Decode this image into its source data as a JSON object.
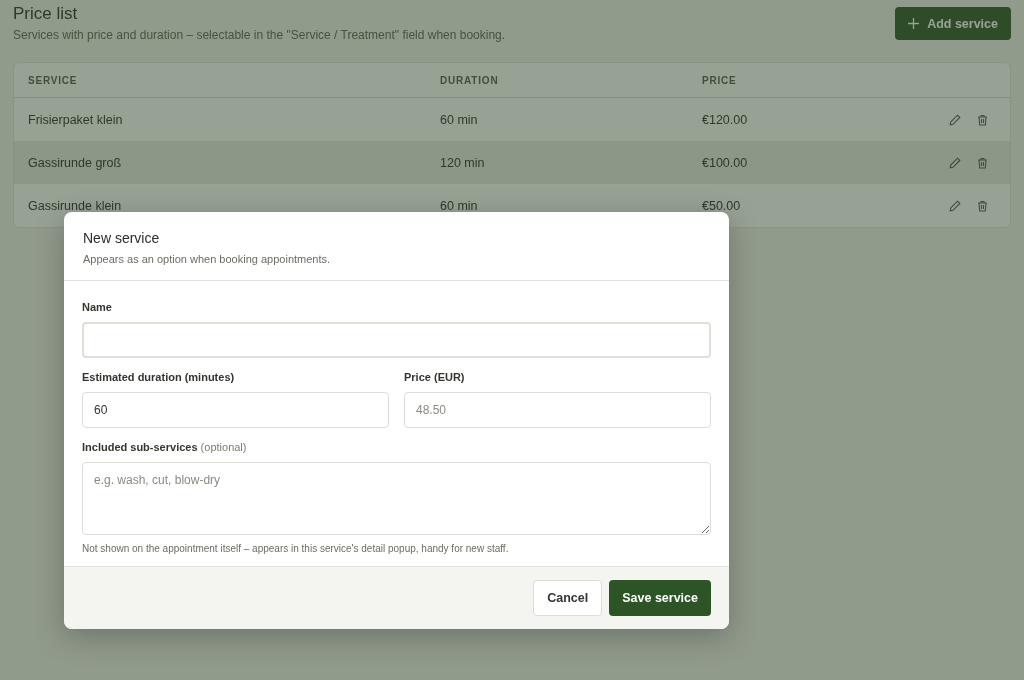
{
  "page": {
    "title": "Price list",
    "subtitle": "Services with price and duration – selectable in the \"Service / Treatment\" field when booking.",
    "add_button": "Add service"
  },
  "table": {
    "columns": [
      "SERVICE",
      "DURATION",
      "PRICE"
    ],
    "rows": [
      {
        "service": "Frisierpaket klein",
        "duration": "60 min",
        "price": "€120.00",
        "highlighted": false
      },
      {
        "service": "Gassirunde groß",
        "duration": "120 min",
        "price": "€100.00",
        "highlighted": true
      },
      {
        "service": "Gassirunde klein",
        "duration": "60 min",
        "price": "€50.00",
        "highlighted": false
      }
    ]
  },
  "dialog": {
    "title": "New service",
    "subtitle": "Appears as an option when booking appointments.",
    "name": {
      "label": "Name"
    },
    "duration": {
      "label": "Estimated duration (minutes)",
      "value": "60"
    },
    "price": {
      "label": "Price (EUR)",
      "placeholder": "48.50"
    },
    "subservices": {
      "label": "Included sub-services",
      "note": "(optional)",
      "placeholder": "e.g. wash, cut, blow-dry"
    },
    "hint": "Not shown on the appointment itself – appears in this service's detail popup, handy for new staff.",
    "buttons": {
      "cancel": "Cancel",
      "save": "Save service"
    }
  }
}
